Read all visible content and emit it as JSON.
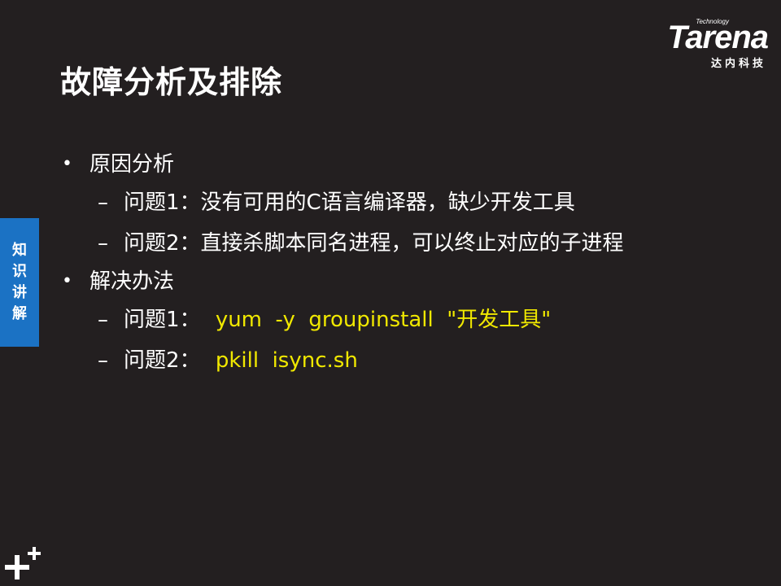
{
  "slide": {
    "title": "故障分析及排除",
    "side_tab": [
      "知",
      "识",
      "讲",
      "解"
    ],
    "logo": {
      "small_text": "Technology",
      "wordmark": "Tarena",
      "chinese": "达内科技"
    },
    "content": {
      "sections": [
        {
          "heading": "原因分析",
          "items": [
            {
              "label": "问题1：没有可用的C语言编译器，缺少开发工具",
              "code": ""
            },
            {
              "label": "问题2：直接杀脚本同名进程，可以终止对应的子进程",
              "code": ""
            }
          ]
        },
        {
          "heading": "解决办法",
          "items": [
            {
              "label": "问题1：",
              "code": "yum  -y  groupinstall  \"开发工具\""
            },
            {
              "label": "问题2：",
              "code": "pkill  isync.sh"
            }
          ]
        }
      ]
    }
  },
  "colors": {
    "background": "#231F20",
    "text": "#FFFFFF",
    "code": "#F0E800",
    "side_tab": "#1B72C4"
  },
  "icons": {
    "bottom_left": "plus-cluster-icon",
    "bullet": "bullet-dot-icon",
    "dash": "en-dash-icon"
  }
}
